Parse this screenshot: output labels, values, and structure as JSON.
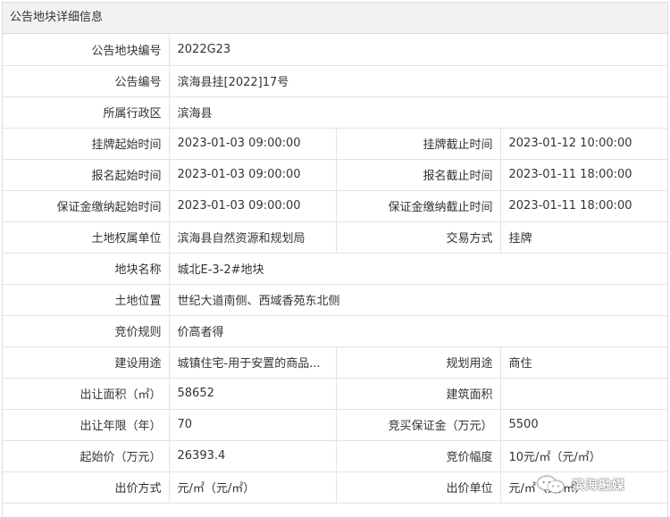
{
  "title": "公告地块详细信息",
  "rows": [
    {
      "l1": "公告地块编号",
      "v1": "2022G23"
    },
    {
      "l1": "公告编号",
      "v1": "滨海县挂[2022]17号"
    },
    {
      "l1": "所属行政区",
      "v1": "滨海县"
    },
    {
      "l1": "挂牌起始时间",
      "v1": "2023-01-03 09:00:00",
      "l2": "挂牌截止时间",
      "v2": "2023-01-12 10:00:00"
    },
    {
      "l1": "报名起始时间",
      "v1": "2023-01-03 09:00:00",
      "l2": "报名截止时间",
      "v2": "2023-01-11 18:00:00"
    },
    {
      "l1": "保证金缴纳起始时间",
      "v1": "2023-01-03 09:00:00",
      "l2": "保证金缴纳截止时间",
      "v2": "2023-01-11 18:00:00"
    },
    {
      "l1": "土地权属单位",
      "v1": "滨海县自然资源和规划局",
      "l2": "交易方式",
      "v2": "挂牌"
    },
    {
      "l1": "地块名称",
      "v1": "城北E-3-2#地块"
    },
    {
      "l1": "土地位置",
      "v1": "世纪大道南侧、西域香苑东北侧"
    },
    {
      "l1": "竞价规则",
      "v1": "价高者得"
    },
    {
      "l1": "建设用途",
      "v1": "城镇住宅-用于安置的商品...",
      "l2": "规划用途",
      "v2": "商住"
    },
    {
      "l1": "出让面积（㎡）",
      "v1": "58652",
      "l2": "建筑面积",
      "v2": ""
    },
    {
      "l1": "出让年限（年）",
      "v1": "70",
      "l2": "竞买保证金（万元）",
      "v2": "5500"
    },
    {
      "l1": "起始价（万元）",
      "v1": "26393.4",
      "l2": "竞价幅度",
      "v2": "10元/㎡（元/㎡）"
    },
    {
      "l1": "出价方式",
      "v1": "元/㎡（元/㎡）",
      "l2": "出价单位",
      "v2": "元/㎡（元/㎡）"
    }
  ],
  "watermark": {
    "text": "滨海融媒",
    "icon": "wechat-icon"
  }
}
